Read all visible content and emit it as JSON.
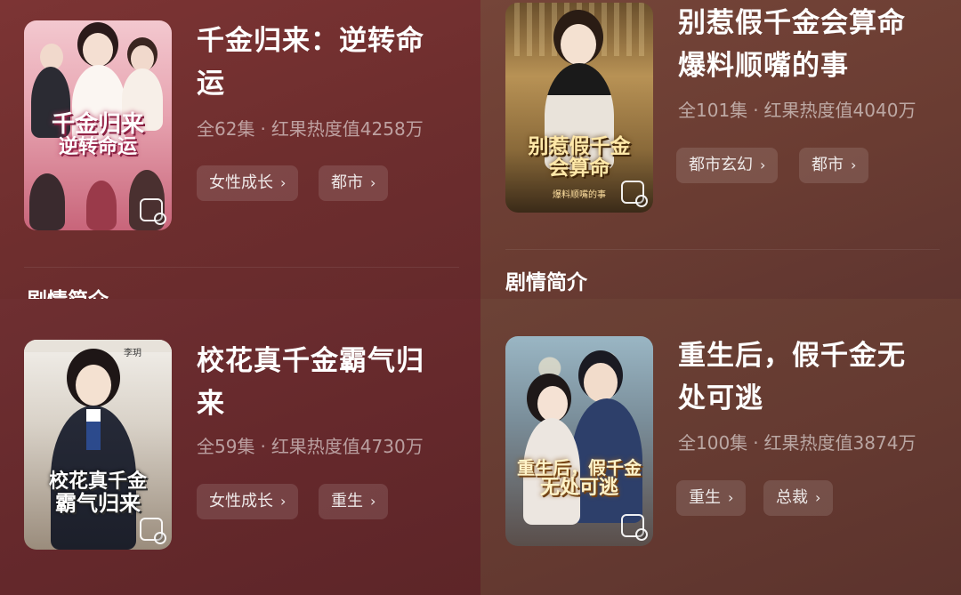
{
  "cards": [
    {
      "title_line1": "千金归来：逆转命",
      "title_line2": "运",
      "episodes": "全62集",
      "heat": "红果热度值4258万",
      "tags": [
        "女性成长",
        "都市"
      ],
      "poster_title_line1": "千金归来",
      "poster_title_line2": "逆转命运"
    },
    {
      "title_line1": "别惹假千金会算命",
      "title_line2": "爆料顺嘴的事",
      "episodes": "全101集",
      "heat": "红果热度值4040万",
      "tags": [
        "都市玄幻",
        "都市"
      ],
      "poster_title_line1": "别惹假千金",
      "poster_title_line2": "会算命",
      "poster_sub": "爆料顺嘴的事"
    },
    {
      "title_line1": "校花真千金霸气归",
      "title_line2": "来",
      "episodes": "全59集",
      "heat": "红果热度值4730万",
      "tags": [
        "女性成长",
        "重生"
      ],
      "poster_title_line1": "校花真千金",
      "poster_title_line2": "霸气归来",
      "poster_name": "李玥"
    },
    {
      "title_line1": "重生后，假千金无",
      "title_line2": "处可逃",
      "episodes": "全100集",
      "heat": "红果热度值3874万",
      "tags": [
        "重生",
        "总裁"
      ],
      "poster_title_line1": "重生后，假千金",
      "poster_title_line2": "无处可逃"
    }
  ],
  "section_heading": "剧情简介",
  "separator": "·",
  "chevron": "›",
  "icons": {
    "play_badge": "video-badge-icon",
    "chevron": "chevron-right-icon"
  }
}
